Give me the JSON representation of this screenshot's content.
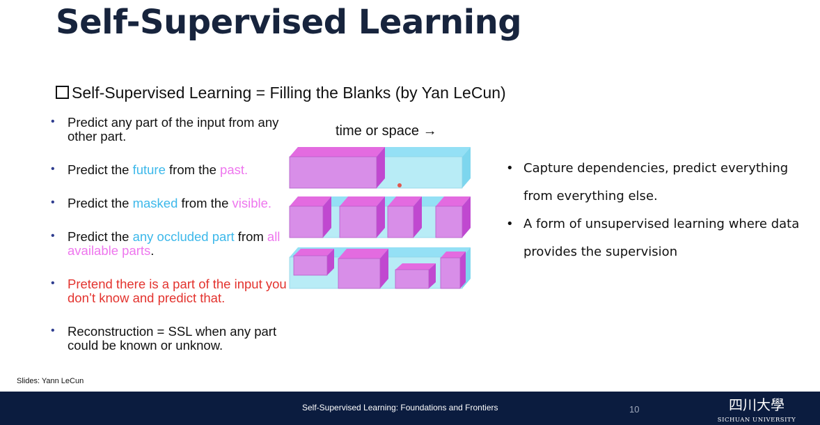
{
  "slide": {
    "title": "Self-Supervised Learning",
    "subtitle": "Self-Supervised Learning = Filling the Blanks  (by Yan LeCun)",
    "credit": "Slides: Yann LeCun"
  },
  "left_bullets": [
    {
      "segments": [
        {
          "text": "Predict any part of the input from any other part.",
          "color": "default"
        }
      ]
    },
    {
      "segments": [
        {
          "text": "Predict the ",
          "color": "default"
        },
        {
          "text": "future",
          "color": "blue"
        },
        {
          "text": " from the ",
          "color": "default"
        },
        {
          "text": "past.",
          "color": "pink"
        }
      ]
    },
    {
      "segments": [
        {
          "text": "Predict the ",
          "color": "default"
        },
        {
          "text": "masked",
          "color": "blue"
        },
        {
          "text": " from the ",
          "color": "default"
        },
        {
          "text": "visible.",
          "color": "pink"
        }
      ]
    },
    {
      "segments": [
        {
          "text": "Predict the ",
          "color": "default"
        },
        {
          "text": "any occluded part",
          "color": "blue"
        },
        {
          "text": " from ",
          "color": "default"
        },
        {
          "text": "all available parts",
          "color": "pink"
        },
        {
          "text": ".",
          "color": "default"
        }
      ]
    },
    {
      "segments": [
        {
          "text": "Pretend there is a part of the input you don’t know and predict that.",
          "color": "red"
        }
      ]
    },
    {
      "segments": [
        {
          "text": "Reconstruction = SSL when any part could be known or unknow.",
          "color": "default"
        }
      ]
    }
  ],
  "diagram": {
    "axis_label": "time or space →",
    "colors": {
      "known": "#d88ee8",
      "known_top": "#e36be0",
      "known_side": "#c048d0",
      "unknown": "#b8ecf6",
      "unknown_top": "#94e0f5",
      "unknown_side": "#7dd6ee"
    }
  },
  "right_bullets": [
    "Capture dependencies, predict everything from everything else.",
    "A form of unsupervised learning where data provides the supervision"
  ],
  "footer": {
    "text": "Self-Supervised Learning: Foundations and Frontiers",
    "page_number": "10",
    "logo_chinese": "四川大學",
    "logo_english": "SICHUAN UNIVERSITY"
  },
  "colors": {
    "default": "#111111",
    "blue": "#3cb8ea",
    "pink": "#ee76ee",
    "red": "#e3332e",
    "footer_bg": "#0b1c3f"
  }
}
